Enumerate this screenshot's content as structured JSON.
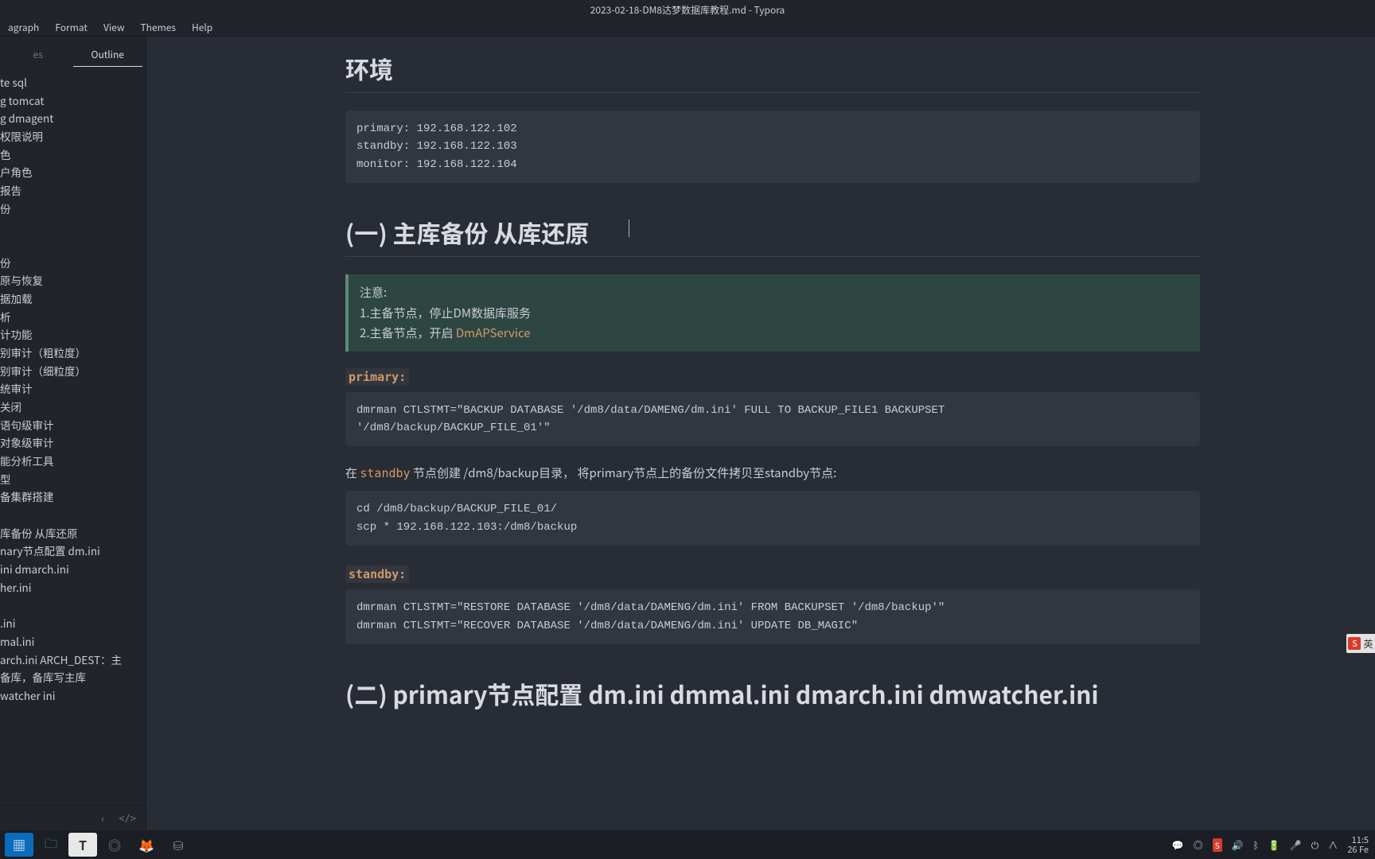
{
  "window": {
    "title": "2023-02-18-DM8达梦数据库教程.md - Typora"
  },
  "menubar": [
    "agraph",
    "Format",
    "View",
    "Themes",
    "Help"
  ],
  "sidebar": {
    "tabs": {
      "left": "es",
      "right": "Outline"
    },
    "outline": [
      "te sql",
      "g tomcat",
      "g dmagent",
      "权限说明",
      "色",
      "户角色",
      "报告",
      "份",
      "",
      "",
      "份",
      "原与恢复",
      "据加载",
      "析",
      "计功能",
      "别审计（粗粒度）",
      "别审计（细粒度）",
      "统审计",
      "关闭",
      "语句级审计",
      "对象级审计",
      "能分析工具",
      "型",
      "备集群搭建",
      "",
      "库备份 从库还原",
      "nary节点配置 dm.ini",
      "ini dmarch.ini",
      "her.ini",
      "",
      ".ini",
      "mal.ini",
      "arch.ini ARCH_DEST：主",
      "备库，备库写主库",
      "watcher ini"
    ]
  },
  "content": {
    "h_env": "环境",
    "code_env": "primary: 192.168.122.102\nstandby: 192.168.122.103\nmonitor: 192.168.122.104",
    "h_1": "(一) 主库备份  从库还原",
    "callout_l1": "注意:",
    "callout_l2_pre": "1.主备节点，停止DM数据库服务",
    "callout_l3_pre": "2.主备节点，开启 ",
    "callout_l3_kw": "DmAPService",
    "label_primary": "primary:",
    "code_primary": "dmrman CTLSTMT=\"BACKUP DATABASE '/dm8/data/DAMENG/dm.ini' FULL TO BACKUP_FILE1 BACKUPSET\n'/dm8/backup/BACKUP_FILE_01'\"",
    "para_pre": "在 ",
    "para_kw": "standby",
    "para_post": " 节点创建 /dm8/backup目录， 将primary节点上的备份文件拷贝至standby节点:",
    "code_cd": "cd /dm8/backup/BACKUP_FILE_01/\nscp * 192.168.122.103:/dm8/backup",
    "label_standby": "standby:",
    "code_standby": "dmrman CTLSTMT=\"RESTORE DATABASE '/dm8/data/DAMENG/dm.ini' FROM BACKUPSET '/dm8/backup'\"\ndmrman CTLSTMT=\"RECOVER DATABASE '/dm8/data/DAMENG/dm.ini' UPDATE DB_MAGIC\"",
    "h_2": "(二) primary节点配置 dm.ini dmmal.ini dmarch.ini dmwatcher.ini"
  },
  "sidebar_footer": {
    "back": "‹",
    "code": "</>"
  },
  "tray": {
    "time": "11:5",
    "date": "26 Fe"
  },
  "ime": {
    "char": "S",
    "label": "英"
  }
}
